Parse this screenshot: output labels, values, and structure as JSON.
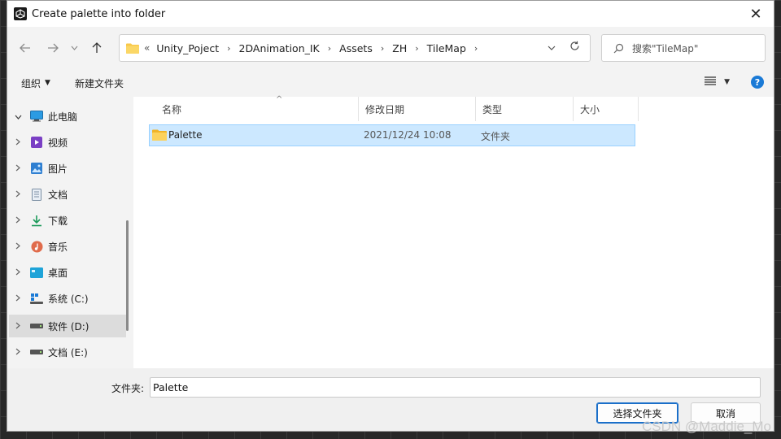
{
  "window": {
    "title": "Create palette into folder",
    "close_glyph": "✕"
  },
  "navigation": {
    "back_icon": "arrow-left-icon",
    "forward_icon": "arrow-right-icon",
    "recent_icon": "chevron-down-icon",
    "up_icon": "arrow-up-icon",
    "address": {
      "lead": "«",
      "crumbs": [
        "Unity_Poject",
        "2DAnimation_IK",
        "Assets",
        "ZH",
        "TileMap"
      ],
      "trailing_separator": "›"
    },
    "search_placeholder": "搜索\"TileMap\""
  },
  "commandbar": {
    "organize_label": "组织",
    "new_folder_label": "新建文件夹"
  },
  "sidebar": {
    "items": [
      {
        "label": "此电脑",
        "icon": "computer-icon",
        "expanded": true,
        "selected": false
      },
      {
        "label": "视频",
        "icon": "video-icon",
        "selected": false
      },
      {
        "label": "图片",
        "icon": "pictures-icon",
        "selected": false
      },
      {
        "label": "文档",
        "icon": "documents-icon",
        "selected": false
      },
      {
        "label": "下载",
        "icon": "download-icon",
        "selected": false
      },
      {
        "label": "音乐",
        "icon": "music-icon",
        "selected": false
      },
      {
        "label": "桌面",
        "icon": "desktop-icon",
        "selected": false
      },
      {
        "label": "系统 (C:)",
        "icon": "windows-drive-icon",
        "selected": false
      },
      {
        "label": "软件 (D:)",
        "icon": "drive-icon",
        "selected": true
      },
      {
        "label": "文档 (E:)",
        "icon": "drive-icon",
        "selected": false
      }
    ]
  },
  "file_list": {
    "columns": [
      "名称",
      "修改日期",
      "类型",
      "大小"
    ],
    "rows": [
      {
        "name": "Palette",
        "modified": "2021/12/24 10:08",
        "type": "文件夹",
        "size": "",
        "selected": true
      }
    ]
  },
  "footer": {
    "folder_label": "文件夹:",
    "folder_value": "Palette",
    "select_button": "选择文件夹",
    "cancel_button": "取消"
  },
  "watermark": "CSDN @Maddie_Mo",
  "colors": {
    "accent": "#1a7ad6",
    "selection_bg": "#cce8ff",
    "selection_border": "#99d1ff",
    "folder_yellow": "#f8c84a"
  }
}
